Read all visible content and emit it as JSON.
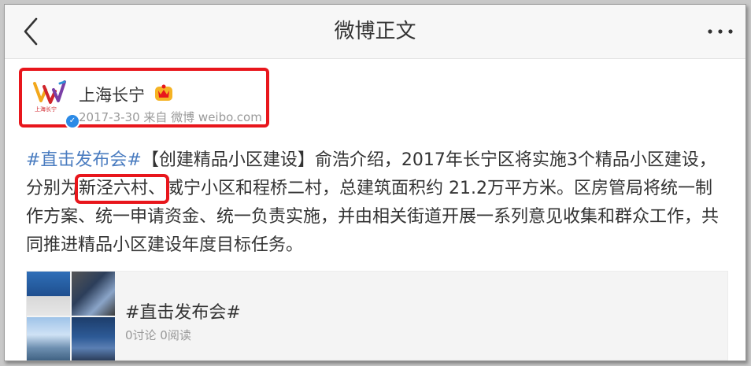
{
  "nav": {
    "title": "微博正文",
    "back_icon": "chevron-left-icon",
    "more_icon": "more-horizontal-icon"
  },
  "author": {
    "name": "上海长宁",
    "avatar_logo_text": "上海长宁",
    "meta": "2017-3-30 来自 微博 weibo.com",
    "verified_icon": "verified-badge-icon",
    "vip_icon": "vip-crown-icon"
  },
  "post": {
    "topic": "#直击发布会#",
    "text_1": "【创建精品小区建设】俞浩介绍，2017年长宁区将实施3个精品小区建设，分别为",
    "highlight": "新泾六村、",
    "text_2": "威宁小区和程桥二村，总建筑面积约 21.2万平方米。区房管局将统一制作方案、统一申请资金、统一负责实施，并由相关街道开展一系列意见收集和群众工作，共同推进精品小区建设年度目标任务。"
  },
  "topic_card": {
    "title": "#直击发布会#",
    "stats": "0讨论 0阅读"
  },
  "colors": {
    "highlight_border": "#e8161c",
    "topic_link": "#4a7cc0",
    "verified": "#2b8ae6"
  }
}
